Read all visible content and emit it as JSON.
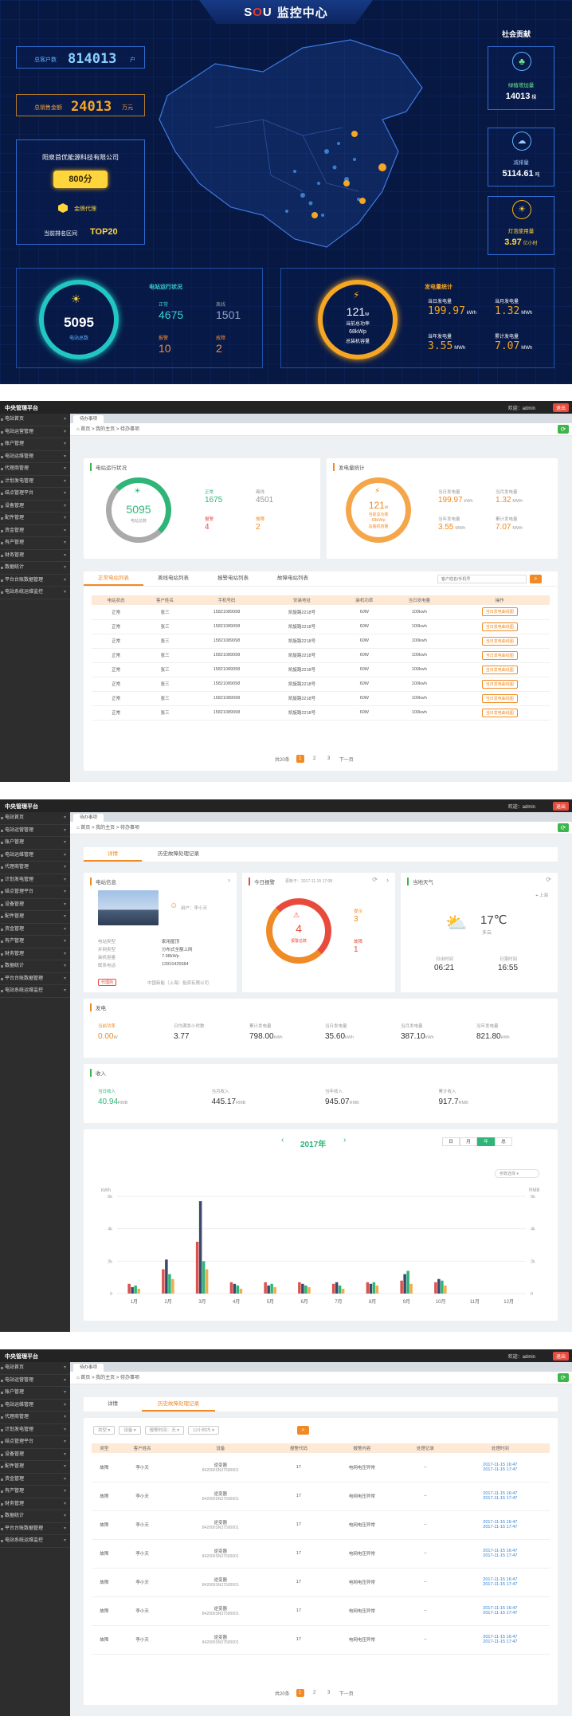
{
  "dashboard": {
    "title_brand_s": "S",
    "title_brand_o": "O",
    "title_brand_u": "U",
    "title_text": "监控中心",
    "customers_label": "总客户数",
    "customers_value": "814013",
    "customers_unit": "户",
    "sales_label": "总销售金额",
    "sales_value": "24013",
    "sales_unit": "万元",
    "company": "阳泉首优能源科技有限公司",
    "score": "800分",
    "agent": "金牌代理",
    "rank_label": "当前排名区间",
    "rank_value": "TOP20",
    "contribution_title": "社会贡献",
    "green_label": "绿植增加量",
    "green_value": "14013",
    "green_unit": "棵",
    "co2_label": "减排量",
    "co2_value": "5114.61",
    "co2_unit": "吨",
    "lamp_label": "灯泡使用量",
    "lamp_value": "3.97",
    "lamp_unit": "亿小时",
    "station_count": "5095",
    "station_count_label": "电站总数",
    "run_title": "电站运行状况",
    "normal_label": "正常",
    "normal_value": "4675",
    "offline_label": "离线",
    "offline_value": "1501",
    "alarm_label": "报警",
    "alarm_value": "10",
    "fault_label": "故障",
    "fault_value": "2",
    "power_value": "121",
    "power_unit": "w",
    "power_label": "当前总功率",
    "capacity_value": "68kWp",
    "capacity_label": "总装机容量",
    "gen_title": "发电量统计",
    "today_label": "当日发电量",
    "today_value": "199.97",
    "today_unit": "kWh",
    "month_label": "当月发电量",
    "month_value": "1.32",
    "month_unit": "MWh",
    "year_label": "当年发电量",
    "year_value": "3.55",
    "year_unit": "MWh",
    "total_label": "累计发电量",
    "total_value": "7.07",
    "total_unit": "MWh"
  },
  "admin": {
    "platform": "中央管理平台",
    "user": "欢迎：admin",
    "exit": "退出",
    "tab": "待办事项",
    "crumb_home": "首页",
    "crumb_mid": "我的主页",
    "crumb_cur": "待办事项",
    "menu": [
      "电站首页",
      "电站运营管理",
      "账户管理",
      "电站运维管理",
      "代理商管理",
      "计划发电管理",
      "结点管理平台",
      "设备管理",
      "配件管理",
      "资金管理",
      "有产管理",
      "财务管理",
      "数据统计",
      "平台台账数据管理",
      "电站系统运维监控"
    ]
  },
  "panel2": {
    "run_title": "电站运行状况",
    "count": "5095",
    "count_label": "电站总数",
    "normal_label": "正常",
    "normal_value": "1675",
    "offline_label": "离线",
    "offline_value": "4501",
    "alarm_label": "报警",
    "alarm_value": "4",
    "fault_label": "故障",
    "fault_value": "2",
    "gen_title": "发电量统计",
    "power_value": "121",
    "power_unit": "w",
    "power_label": "当前总功率",
    "cap_value": "68kWp",
    "cap_label": "总装机容量",
    "today_label": "当日发电量",
    "today_value": "199.97",
    "today_unit": "kWh",
    "month_label": "当月发电量",
    "month_value": "1.32",
    "month_unit": "MWh",
    "year_label": "当年发电量",
    "year_value": "3.55",
    "year_unit": "MWh",
    "total_label": "累计发电量",
    "total_value": "7.07",
    "total_unit": "MWh",
    "tabs": [
      "正常电站列表",
      "离线电站列表",
      "报警电站列表",
      "故障电站列表"
    ],
    "search_placeholder": "客户姓名/手机号",
    "columns": [
      "电站状态",
      "客户姓名",
      "手机号码",
      "安装地址",
      "装机功率",
      "当日发电量",
      "操作"
    ],
    "rows": [
      [
        "正常",
        "张三",
        "15821089098",
        "凯旋路2218号",
        "60W",
        "100kwh",
        "当日发电曲线图"
      ],
      [
        "正常",
        "张三",
        "15821089098",
        "凯旋路2218号",
        "60W",
        "100kwh",
        "当日发电曲线图"
      ],
      [
        "正常",
        "张三",
        "15821089098",
        "凯旋路2218号",
        "60W",
        "100kwh",
        "当日发电曲线图"
      ],
      [
        "正常",
        "张三",
        "15821089098",
        "凯旋路2218号",
        "60W",
        "100kwh",
        "当日发电曲线图"
      ],
      [
        "正常",
        "张三",
        "15821089098",
        "凯旋路2218号",
        "60W",
        "100kwh",
        "当日发电曲线图"
      ],
      [
        "正常",
        "张三",
        "15821089098",
        "凯旋路2218号",
        "60W",
        "100kwh",
        "当日发电曲线图"
      ],
      [
        "正常",
        "张三",
        "15821089098",
        "凯旋路2218号",
        "60W",
        "100kwh",
        "当日发电曲线图"
      ],
      [
        "正常",
        "张三",
        "15821089098",
        "凯旋路2218号",
        "60W",
        "100kwh",
        "当日发电曲线图"
      ]
    ],
    "pager_total": "共20条",
    "pages": [
      "1",
      "2",
      "3"
    ],
    "next": "下一页"
  },
  "panel3": {
    "tabs": [
      "详情",
      "历史故障处理记录"
    ],
    "info_title": "电站信息",
    "customer": "用户：李小天",
    "info_rows": [
      [
        "电站类型",
        "家用屋顶"
      ],
      [
        "并网类型",
        "分布式全额上网"
      ],
      [
        "装机容量",
        "7.98kWp"
      ],
      [
        "联系电话",
        "13916425684"
      ]
    ],
    "agent_badge": "代理商",
    "agent_name": "中国新能（上海）投资有限公司",
    "alarm_title": "今日报警",
    "alarm_date": "更新于：2017-11-15 17:08",
    "alarm_count": "4",
    "alarm_count_label": "报警总数",
    "alert_label": "提示",
    "alert_value": "3",
    "fault_label": "故障",
    "fault_value": "1",
    "weather_title": "当地天气",
    "city": "上海",
    "temp": "17℃",
    "cond": "多云",
    "sunrise_label": "日出时间",
    "sunrise": "06:21",
    "sunset_label": "日落时间",
    "sunset": "16:55",
    "gen_title": "发电",
    "gen_items": [
      [
        "当前功率",
        "0.00",
        "W"
      ],
      [
        "日均满发小时数",
        "3.77",
        ""
      ],
      [
        "累计发电量",
        "798.00",
        "kWh"
      ],
      [
        "当日发电量",
        "35.60",
        "kWh"
      ],
      [
        "当月发电量",
        "387.10",
        "kWh"
      ],
      [
        "当年发电量",
        "821.80",
        "kWh"
      ]
    ],
    "income_title": "收入",
    "income_items": [
      [
        "当日收入",
        "40.94",
        "RMB"
      ],
      [
        "当月收入",
        "445.17",
        "RMB"
      ],
      [
        "当年收入",
        "945.07",
        "RMB"
      ],
      [
        "累计收入",
        "917.7",
        "RMB"
      ]
    ],
    "year": "2017年",
    "ranges": [
      "日",
      "月",
      "年",
      "总"
    ],
    "param_select": "参数选择",
    "y_left": "kWh",
    "y_right": "RMB"
  },
  "chart_data": {
    "type": "bar",
    "title": "2017年",
    "categories": [
      "1月",
      "2月",
      "3月",
      "4月",
      "5月",
      "6月",
      "7月",
      "8月",
      "9月",
      "10月",
      "11月",
      "12月"
    ],
    "ylabel": "kWh",
    "ylim": [
      0,
      6000
    ],
    "yticks": [
      "6k",
      "4k",
      "2k",
      "0"
    ],
    "ylabel_right": "RMB",
    "yticks_right": [
      "6k",
      "4k",
      "2k",
      "0"
    ],
    "series": [
      {
        "values": [
          600,
          1500,
          3200,
          700,
          700,
          700,
          600,
          700,
          800,
          700,
          0,
          0
        ],
        "color": "#d9534f"
      },
      {
        "values": [
          400,
          2100,
          5700,
          600,
          500,
          600,
          700,
          600,
          1200,
          900,
          0,
          0
        ],
        "color": "#3b4a6b"
      },
      {
        "values": [
          500,
          1200,
          2000,
          500,
          600,
          500,
          500,
          700,
          1400,
          800,
          0,
          0
        ],
        "color": "#2fb578"
      },
      {
        "values": [
          300,
          900,
          1500,
          300,
          400,
          400,
          300,
          500,
          600,
          500,
          0,
          0
        ],
        "color": "#f0ad4e"
      }
    ],
    "grid": true
  },
  "panel4": {
    "tabs": [
      "详情",
      "历史故障处理记录"
    ],
    "filters": [
      "类型",
      "设备",
      "报警时间：无",
      "12小时内"
    ],
    "columns": [
      "类型",
      "客户姓名",
      "设备",
      "报警代码",
      "报警内容",
      "处理记录",
      "处理时间"
    ],
    "rows": [
      [
        "故障",
        "李小天",
        "逆变器",
        "842000SN37500001",
        "17",
        "电网电压异常",
        "--",
        "2017-11-15 16:47",
        "2017-11-15 17:47"
      ],
      [
        "故障",
        "李小天",
        "逆变器",
        "842000SN37500001",
        "17",
        "电网电压异常",
        "--",
        "2017-11-15 16:47",
        "2017-11-15 17:47"
      ],
      [
        "故障",
        "李小天",
        "逆变器",
        "842000SN37500001",
        "17",
        "电网电压异常",
        "--",
        "2017-11-15 16:47",
        "2017-11-15 17:47"
      ],
      [
        "故障",
        "李小天",
        "逆变器",
        "842000SN37500001",
        "17",
        "电网电压异常",
        "--",
        "2017-11-15 16:47",
        "2017-11-15 17:47"
      ],
      [
        "故障",
        "李小天",
        "逆变器",
        "842000SN37500001",
        "17",
        "电网电压异常",
        "--",
        "2017-11-15 16:47",
        "2017-11-15 17:47"
      ],
      [
        "故障",
        "李小天",
        "逆变器",
        "842000SN37500001",
        "17",
        "电网电压异常",
        "--",
        "2017-11-15 16:47",
        "2017-11-15 17:47"
      ],
      [
        "故障",
        "李小天",
        "逆变器",
        "842000SN37500001",
        "17",
        "电网电压异常",
        "--",
        "2017-11-15 16:47",
        "2017-11-15 17:47"
      ]
    ],
    "pager_total": "共20条",
    "pages": [
      "1",
      "2",
      "3"
    ],
    "next": "下一页"
  }
}
